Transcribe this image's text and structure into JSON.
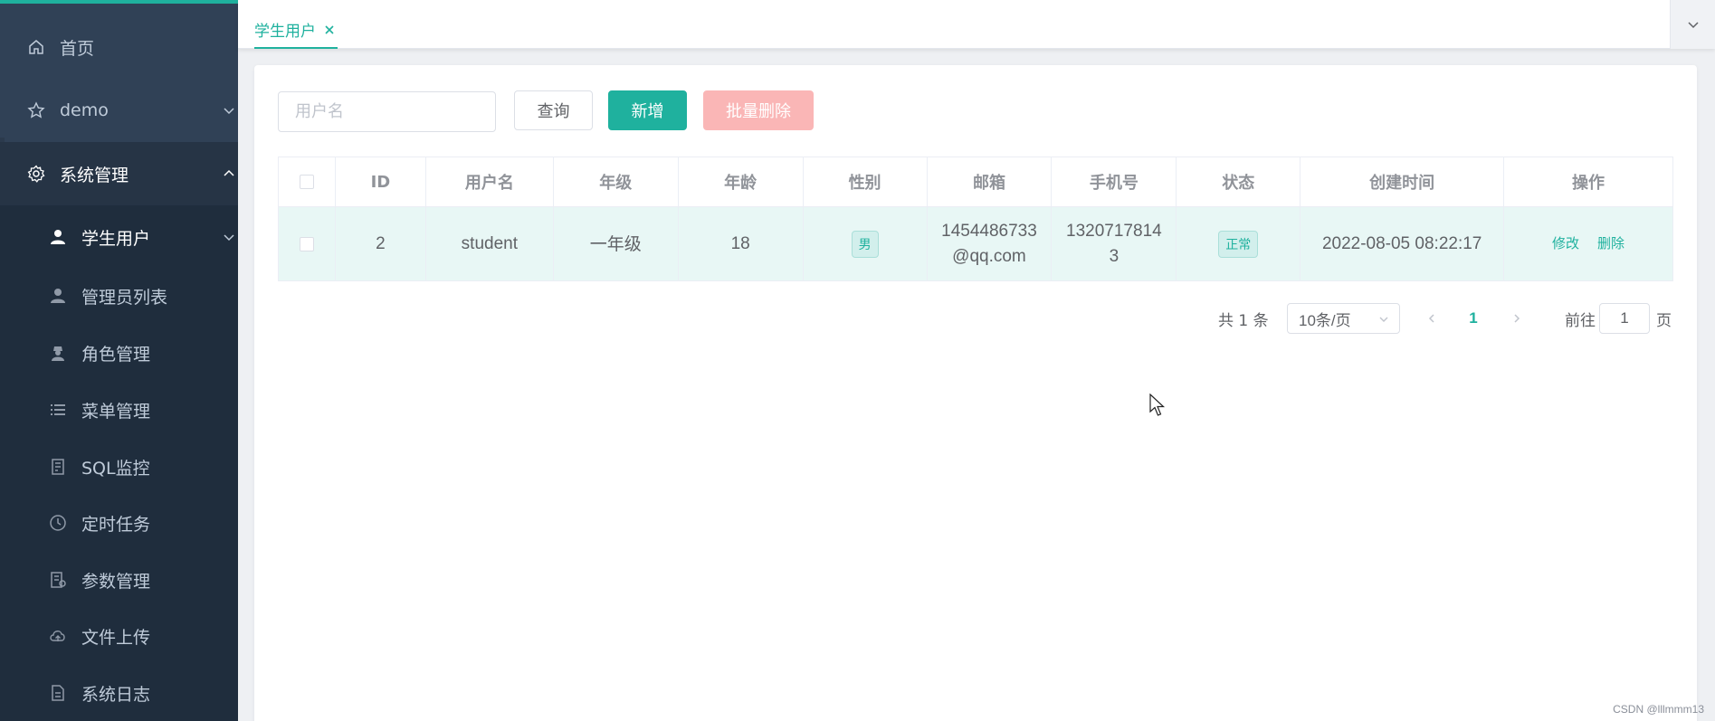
{
  "colors": {
    "accent": "#1fb19e",
    "sidebar_bg": "#304156",
    "submenu_bg": "#1f2d3d",
    "danger_light": "#fab6b6"
  },
  "sidebar": {
    "items": [
      {
        "label": "首页",
        "icon": "home-icon"
      },
      {
        "label": "demo",
        "icon": "star-icon"
      },
      {
        "label": "系统管理",
        "icon": "gear-icon"
      }
    ],
    "subitems": [
      {
        "label": "学生用户",
        "icon": "user-icon"
      },
      {
        "label": "管理员列表",
        "icon": "user-icon"
      },
      {
        "label": "角色管理",
        "icon": "role-icon"
      },
      {
        "label": "菜单管理",
        "icon": "list-icon"
      },
      {
        "label": "SQL监控",
        "icon": "monitor-icon"
      },
      {
        "label": "定时任务",
        "icon": "clock-icon"
      },
      {
        "label": "参数管理",
        "icon": "params-icon"
      },
      {
        "label": "文件上传",
        "icon": "cloud-upload-icon"
      },
      {
        "label": "系统日志",
        "icon": "document-icon"
      }
    ]
  },
  "tabs": {
    "active": "学生用户"
  },
  "toolbar": {
    "search_placeholder": "用户名",
    "search_value": "",
    "query_label": "查询",
    "add_label": "新增",
    "batch_delete_label": "批量删除"
  },
  "table": {
    "columns": [
      "ID",
      "用户名",
      "年级",
      "年龄",
      "性别",
      "邮箱",
      "手机号",
      "状态",
      "创建时间",
      "操作"
    ],
    "rows": [
      {
        "id": "2",
        "username": "student",
        "grade": "一年级",
        "age": "18",
        "gender": "男",
        "email_line1": "1454486733",
        "email_line2": "@qq.com",
        "phone_line1": "1320717814",
        "phone_line2": "3",
        "status": "正常",
        "created": "2022-08-05 08:22:17",
        "edit": "修改",
        "delete": "删除"
      }
    ]
  },
  "pagination": {
    "total_text": "共 1 条",
    "page_size": "10条/页",
    "current_page": "1",
    "goto_label": "前往",
    "goto_value": "1",
    "page_suffix": "页"
  },
  "watermark": "CSDN @lllmmm13"
}
